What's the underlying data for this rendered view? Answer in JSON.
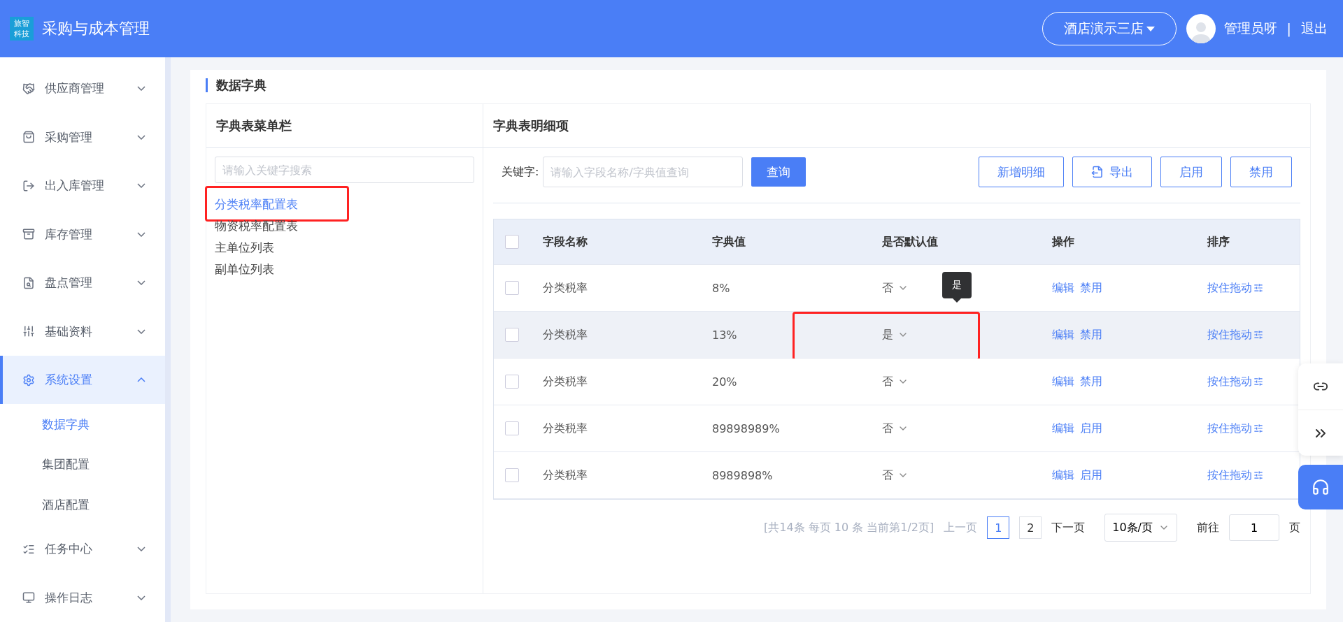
{
  "header": {
    "logo": "旅智科技",
    "title": "采购与成本管理",
    "store": "酒店演示三店",
    "user": "管理员呀",
    "separator": "|",
    "logout": "退出"
  },
  "sidebar": {
    "items": [
      {
        "label": "供应商管理",
        "expanded": false,
        "selected": false
      },
      {
        "label": "采购管理",
        "expanded": false,
        "selected": false
      },
      {
        "label": "出入库管理",
        "expanded": false,
        "selected": false
      },
      {
        "label": "库存管理",
        "expanded": false,
        "selected": false
      },
      {
        "label": "盘点管理",
        "expanded": false,
        "selected": false
      },
      {
        "label": "基础资料",
        "expanded": false,
        "selected": false
      },
      {
        "label": "系统设置",
        "expanded": true,
        "selected": true,
        "children": [
          {
            "label": "数据字典",
            "selected": true
          },
          {
            "label": "集团配置",
            "selected": false
          },
          {
            "label": "酒店配置",
            "selected": false
          }
        ]
      },
      {
        "label": "任务中心",
        "expanded": false,
        "selected": false
      },
      {
        "label": "操作日志",
        "expanded": false,
        "selected": false
      }
    ]
  },
  "page_title": "数据字典",
  "menu_panel": {
    "title": "字典表菜单栏",
    "search": {
      "placeholder": "请输入关键字搜索"
    },
    "items": [
      {
        "label": "分类税率配置表",
        "selected": true,
        "highlighted": true
      },
      {
        "label": "物资税率配置表",
        "selected": false,
        "highlighted": false
      },
      {
        "label": "主单位列表",
        "selected": false,
        "highlighted": false
      },
      {
        "label": "副单位列表",
        "selected": false,
        "highlighted": false
      }
    ]
  },
  "detail_panel": {
    "title": "字典表明细项",
    "keyword_label": "关键字:",
    "keyword": {
      "placeholder": "请输入字段名称/字典值查询"
    },
    "query_button": "查询",
    "buttons": [
      {
        "label": "新增明细",
        "kind": "plain"
      },
      {
        "label": "导出",
        "kind": "export"
      },
      {
        "label": "启用",
        "kind": "plain"
      },
      {
        "label": "禁用",
        "kind": "plain"
      }
    ],
    "table": {
      "all_checked": false,
      "columns": [
        "字段名称",
        "字典值",
        "是否默认值",
        "操作",
        "排序"
      ],
      "rows": [
        {
          "checked": false,
          "hovered": false,
          "field": "分类税率",
          "value": "8%",
          "default": "否",
          "highlighted": false,
          "tooltip": "是",
          "actions": [
            "编辑",
            "禁用"
          ],
          "sort": "按住拖动"
        },
        {
          "checked": false,
          "hovered": true,
          "field": "分类税率",
          "value": "13%",
          "default": "是",
          "highlighted": true,
          "actions": [
            "编辑",
            "禁用"
          ],
          "sort": "按住拖动"
        },
        {
          "checked": false,
          "hovered": false,
          "field": "分类税率",
          "value": "20%",
          "default": "否",
          "highlighted": false,
          "actions": [
            "编辑",
            "禁用"
          ],
          "sort": "按住拖动"
        },
        {
          "checked": false,
          "hovered": false,
          "field": "分类税率",
          "value": "89898989%",
          "default": "否",
          "highlighted": false,
          "actions": [
            "编辑",
            "启用"
          ],
          "sort": "按住拖动"
        },
        {
          "checked": false,
          "hovered": false,
          "field": "分类税率",
          "value": "8989898%",
          "default": "否",
          "highlighted": false,
          "actions": [
            "编辑",
            "启用"
          ],
          "sort": "按住拖动"
        }
      ]
    },
    "pagination": {
      "summary": "[共14条 每页 10 条 当前第1/2页]",
      "prev": "上一页",
      "pages": [
        {
          "label": "1",
          "selected": true
        },
        {
          "label": "2",
          "selected": false
        }
      ],
      "next": "下一页",
      "page_size": "10条/页",
      "goto_label": "前往",
      "goto_value": "1",
      "goto_suffix": "页"
    }
  }
}
